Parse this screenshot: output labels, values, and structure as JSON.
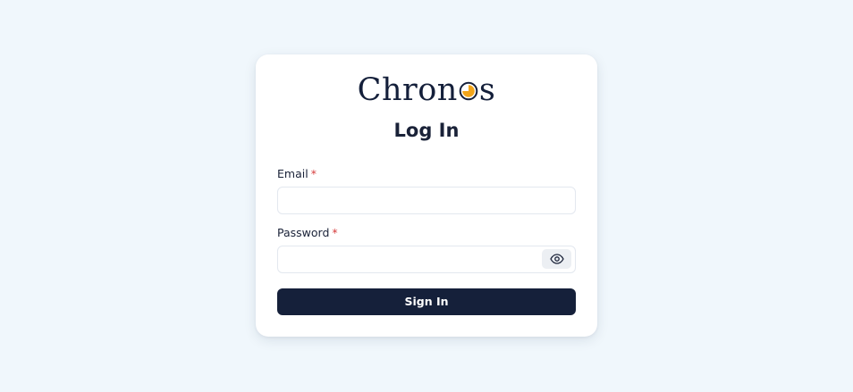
{
  "brand": {
    "name_before": "Chron",
    "name_after": "s",
    "mark_icon": "clock-moon-icon",
    "accent_color": "#f2a51a",
    "text_color": "#141f3a"
  },
  "page": {
    "title": "Log In"
  },
  "form": {
    "email_label": "Email",
    "email_value": "",
    "password_label": "Password",
    "password_value": "",
    "required_marker": "*",
    "toggle_icon": "eye-icon",
    "submit_label": "Sign In"
  },
  "colors": {
    "background": "#f0f7fc",
    "card": "#ffffff",
    "primary_button": "#15203a",
    "required": "#d63c3c"
  }
}
